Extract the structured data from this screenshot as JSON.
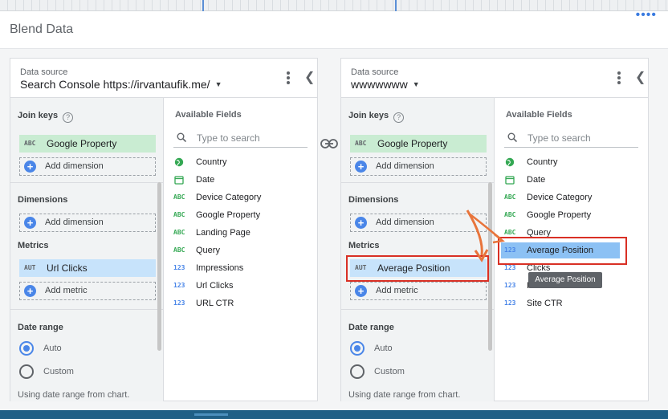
{
  "dialog": {
    "title": "Blend Data"
  },
  "sources": [
    {
      "label": "Data source",
      "name": "Search Console https://irvantaufik.me/",
      "join_keys_label": "Join keys",
      "join_key": {
        "type": "ABC",
        "label": "Google Property"
      },
      "add_dimension_label": "Add dimension",
      "dimensions_label": "Dimensions",
      "metrics_label": "Metrics",
      "metric": {
        "type": "AUT",
        "label": "Url Clicks"
      },
      "add_metric_label": "Add metric",
      "date_range_label": "Date range",
      "auto_label": "Auto",
      "custom_label": "Custom",
      "date_note": "Using date range from chart.",
      "available_fields_label": "Available Fields",
      "search_placeholder": "Type to search",
      "fields": [
        {
          "type": "globe",
          "label": "Country"
        },
        {
          "type": "date",
          "label": "Date"
        },
        {
          "type": "ABC",
          "label": "Device Category"
        },
        {
          "type": "ABC",
          "label": "Google Property"
        },
        {
          "type": "ABC",
          "label": "Landing Page"
        },
        {
          "type": "ABC",
          "label": "Query"
        },
        {
          "type": "123",
          "label": "Impressions"
        },
        {
          "type": "123",
          "label": "Url Clicks"
        },
        {
          "type": "123",
          "label": "URL CTR"
        }
      ]
    },
    {
      "label": "Data source",
      "name": "wwwwwww",
      "join_keys_label": "Join keys",
      "join_key": {
        "type": "ABC",
        "label": "Google Property"
      },
      "add_dimension_label": "Add dimension",
      "dimensions_label": "Dimensions",
      "metrics_label": "Metrics",
      "metric": {
        "type": "AUT",
        "label": "Average Position"
      },
      "add_metric_label": "Add metric",
      "date_range_label": "Date range",
      "auto_label": "Auto",
      "custom_label": "Custom",
      "date_note": "Using date range from chart.",
      "available_fields_label": "Available Fields",
      "search_placeholder": "Type to search",
      "fields": [
        {
          "type": "globe",
          "label": "Country"
        },
        {
          "type": "date",
          "label": "Date"
        },
        {
          "type": "ABC",
          "label": "Device Category"
        },
        {
          "type": "ABC",
          "label": "Google Property"
        },
        {
          "type": "ABC",
          "label": "Query"
        },
        {
          "type": "123",
          "label": "Average Position",
          "selected": true
        },
        {
          "type": "123",
          "label": "Clicks"
        },
        {
          "type": "123",
          "label": "I"
        },
        {
          "type": "123",
          "label": "Site CTR"
        }
      ]
    }
  ],
  "tooltip": {
    "text": "Average Position"
  },
  "colors": {
    "accent": "#4a86e8",
    "join_key_bg": "#c9ecd2",
    "metric_bg": "#c7e3fb",
    "selected_field_bg": "#8cc1f4",
    "annotation_red": "#d93025",
    "arrow_orange": "#e8743b"
  },
  "icons": {
    "more": "more-vert-icon",
    "collapse": "chevron-left-icon",
    "link": "link-icon",
    "help": "help-circle-icon",
    "search": "search-icon",
    "add": "add-circle-icon"
  }
}
